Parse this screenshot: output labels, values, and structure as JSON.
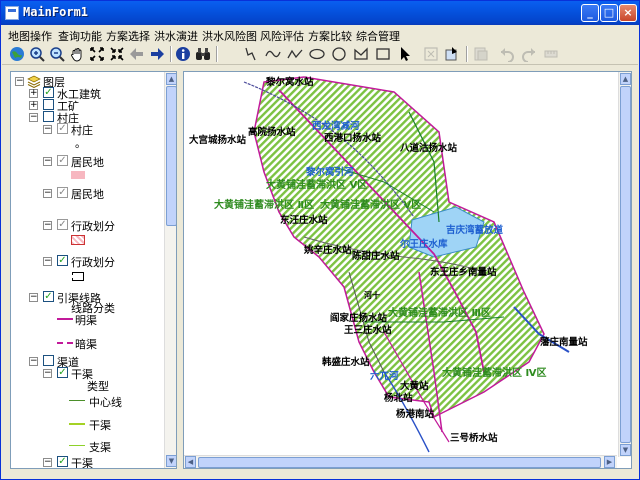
{
  "window": {
    "title": "MainForm1",
    "min": "_",
    "max": "□",
    "close": "×"
  },
  "menu": [
    "地图操作",
    "查询功能",
    "方案选择",
    "洪水演进",
    "洪水风险图",
    "风险评估",
    "方案比较",
    "综合管理"
  ],
  "toolbar_icons": [
    "globe-icon",
    "zoom-in-icon",
    "zoom-out-icon",
    "pan-hand-icon",
    "full-extent-icon",
    "fixed-zoom-icon",
    "back-icon",
    "forward-icon",
    "info-icon",
    "find-binoculars-icon",
    "draw-freehand-icon",
    "draw-curve-icon",
    "draw-polyline-icon",
    "draw-ellipse-icon",
    "draw-circle-icon",
    "draw-polygon-icon",
    "draw-rectangle-icon",
    "select-pointer-icon",
    "clear-select-icon",
    "edit-vertex-icon",
    "layer-props-icon",
    "undo-icon",
    "redo-icon",
    "measure-icon"
  ],
  "toc": {
    "root": "图层",
    "items": [
      {
        "label": "水工建筑"
      },
      {
        "label": "工矿"
      },
      {
        "label": "村庄"
      },
      {
        "label": "村庄"
      },
      {
        "label": "居民地"
      },
      {
        "label": "居民地"
      },
      {
        "label": "行政划分"
      },
      {
        "label": "引渠线路"
      },
      {
        "label": "线路分类"
      },
      {
        "label": "明渠"
      },
      {
        "label": "暗渠"
      },
      {
        "label": "渠道"
      },
      {
        "label": "干渠"
      },
      {
        "label": "类型"
      },
      {
        "label": "中心线"
      },
      {
        "label": "干渠"
      },
      {
        "label": "支渠"
      },
      {
        "label": "干渠"
      }
    ],
    "legend_dot": "。"
  },
  "map": {
    "labels": [
      "黎尔窝水站",
      "大宫城扬水站",
      "高院扬水站",
      "西港口扬水站",
      "八道沽扬水站",
      "西龙湾减河",
      "黎尔窝引河",
      "大黄铺洼蓄滞洪区 Ⅴ区",
      "大黄铺洼蓄滞洪区 Ⅱ区",
      "大黄铺洼蓄滞洪区 Ⅴ区",
      "东汪庄水站",
      "吉庆湾蓄放道",
      "尔王庄水库",
      "姚辛庄水站",
      "陈甜庄水站",
      "东王庄乡南量站",
      "阎家庄扬水站",
      "王三庄水站",
      "大黄铺洼蓄滞洪区 Ⅲ区",
      "藩庄南量站",
      "韩盛庄水站",
      "大黄铺洼蓄滞洪区 Ⅳ区",
      "大黄站",
      "杨北站",
      "杨港南站",
      "三号桥水站",
      "六兀河",
      "河十"
    ]
  }
}
